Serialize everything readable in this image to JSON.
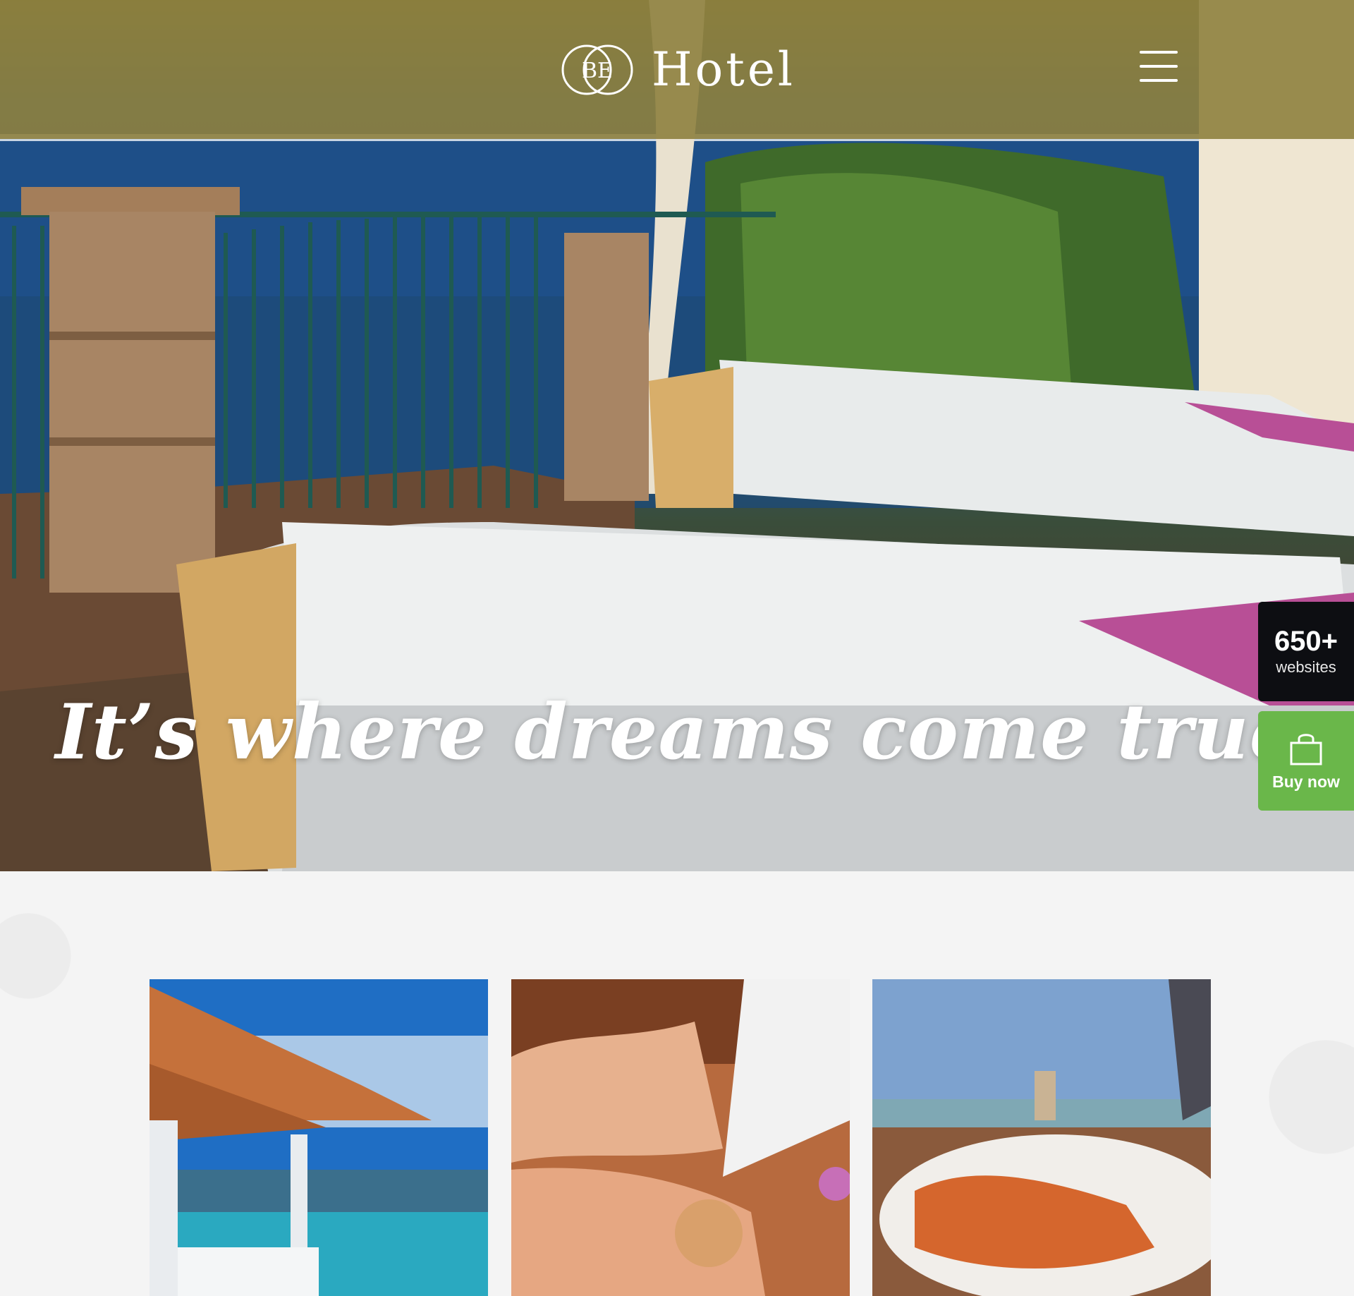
{
  "brand": {
    "logo_initials": "BE",
    "name": "Hotel"
  },
  "hero": {
    "tagline": "It’s where dreams come true"
  },
  "badges": {
    "websites_count": "650+",
    "websites_label": "websites",
    "buy_label": "Buy now",
    "buy_icon": "shopping-bag-icon",
    "buy_color": "#6ab74a",
    "websites_color": "#0d0e12"
  },
  "colors": {
    "header": "#8e813e"
  },
  "tiles": [
    {
      "name": "resort-pavilion-photo"
    },
    {
      "name": "spa-massage-photo"
    },
    {
      "name": "seafood-dinner-photo"
    }
  ]
}
